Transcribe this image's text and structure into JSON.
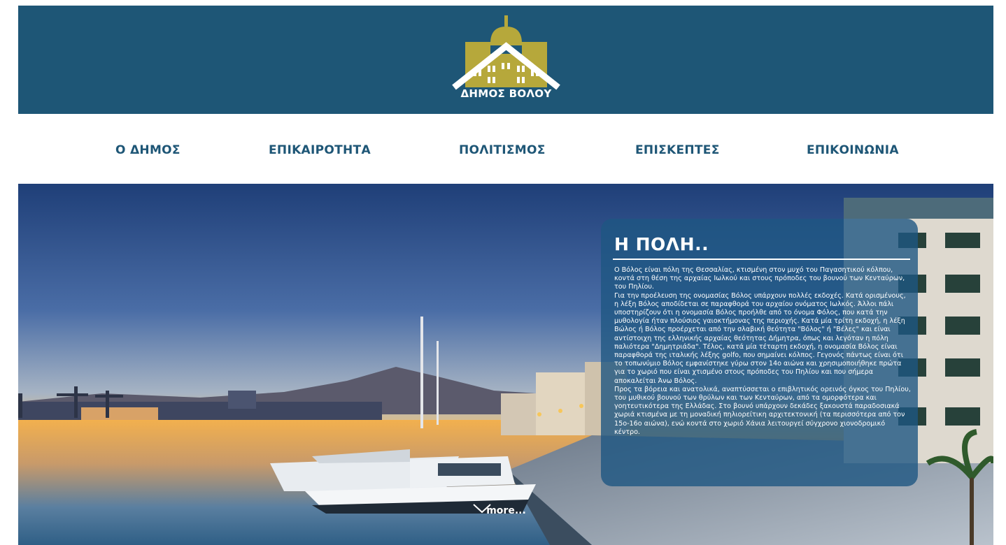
{
  "header": {
    "logo_text": "ΔΗΜΟΣ ΒΟΛΟΥ",
    "colors": {
      "background": "#1e5676",
      "logo": "#b6a83b"
    }
  },
  "nav": {
    "items": [
      {
        "label": "Ο ΔΗΜΟΣ"
      },
      {
        "label": "ΕΠΙΚΑΙΡΟΤΗΤΑ"
      },
      {
        "label": "ΠΟΛΙΤΙΣΜΟΣ"
      },
      {
        "label": "ΕΠΙΣΚΕΠΤΕΣ"
      },
      {
        "label": "ΕΠΙΚΟΙΝΩΝΙΑ"
      }
    ]
  },
  "hero": {
    "panel": {
      "title": "Η ΠΟΛΗ..",
      "paragraphs": [
        "Ο Βόλος είναι πόλη της Θεσσαλίας, κτισμένη στον μυχό του Παγασητικού κόλπου, κοντά στη θέση της αρχαίας Ιωλκού και στους πρόποδες του βουνού των Κενταύρων, του Πηλίου.",
        "Για την προέλευση της ονομασίας Βόλος υπάρχουν πολλές εκδοχές. Κατά ορισμένους, η λέξη Βόλος αποδίδεται σε παραφθορά του αρχαίου ονόματος Ιωλκός. Άλλοι πάλι υποστηρίζουν ότι η ονομασία Βόλος προήλθε από το όνομα Φόλος, που κατά την μυθολογία ήταν πλούσιος γαιοκτήμονας της περιοχής. Κατά μία τρίτη εκδοχή, η λέξη Βώλος ή Βόλος προέρχεται από την σλαβική θεότητα \"Βόλος\" ή \"Βέλες\" και είναι αντίστοιχη της ελληνικής αρχαίας θεότητας Δήμητρα, όπως και λεγόταν η πόλη παλιότερα \"Δημητριάδα\". Τέλος, κατά μία τέταρτη εκδοχή, η ονομασία Βόλος είναι παραφθορά της ιταλικής λέξης golfo, που σημαίνει κόλπος. Γεγονός πάντως είναι ότι το τοπωνύμιο Βόλος εμφανίστηκε γύρω στον 14ο αιώνα και χρησιμοποιήθηκε πρώτα για το χωριό που είναι χτισμένο στους πρόποδες του Πηλίου και που σήμερα αποκαλείται Άνω Βόλος.",
        "Προς τα βόρεια και ανατολικά, αναπτύσσεται ο επιβλητικός ορεινός όγκος του Πηλίου, του μυθικού βουνού των θρύλων και των Κενταύρων, από τα ομορφότερα και γοητευτικότερα της Ελλάδας. Στο βουνό υπάρχουν δεκάδες ξακουστά παραδοσιακά χωριά κτισμένα με τη μοναδική πηλιορείτικη αρχιτεκτονική (τα περισσότερα από τον 15ο-16ο αιώνα), ενώ κοντά στο χωριό Χάνια λειτουργεί σύγχρονο χιονοδρομικό κέντρο."
      ]
    },
    "more_label": "more...",
    "more_icon": "chevron-down-icon"
  }
}
